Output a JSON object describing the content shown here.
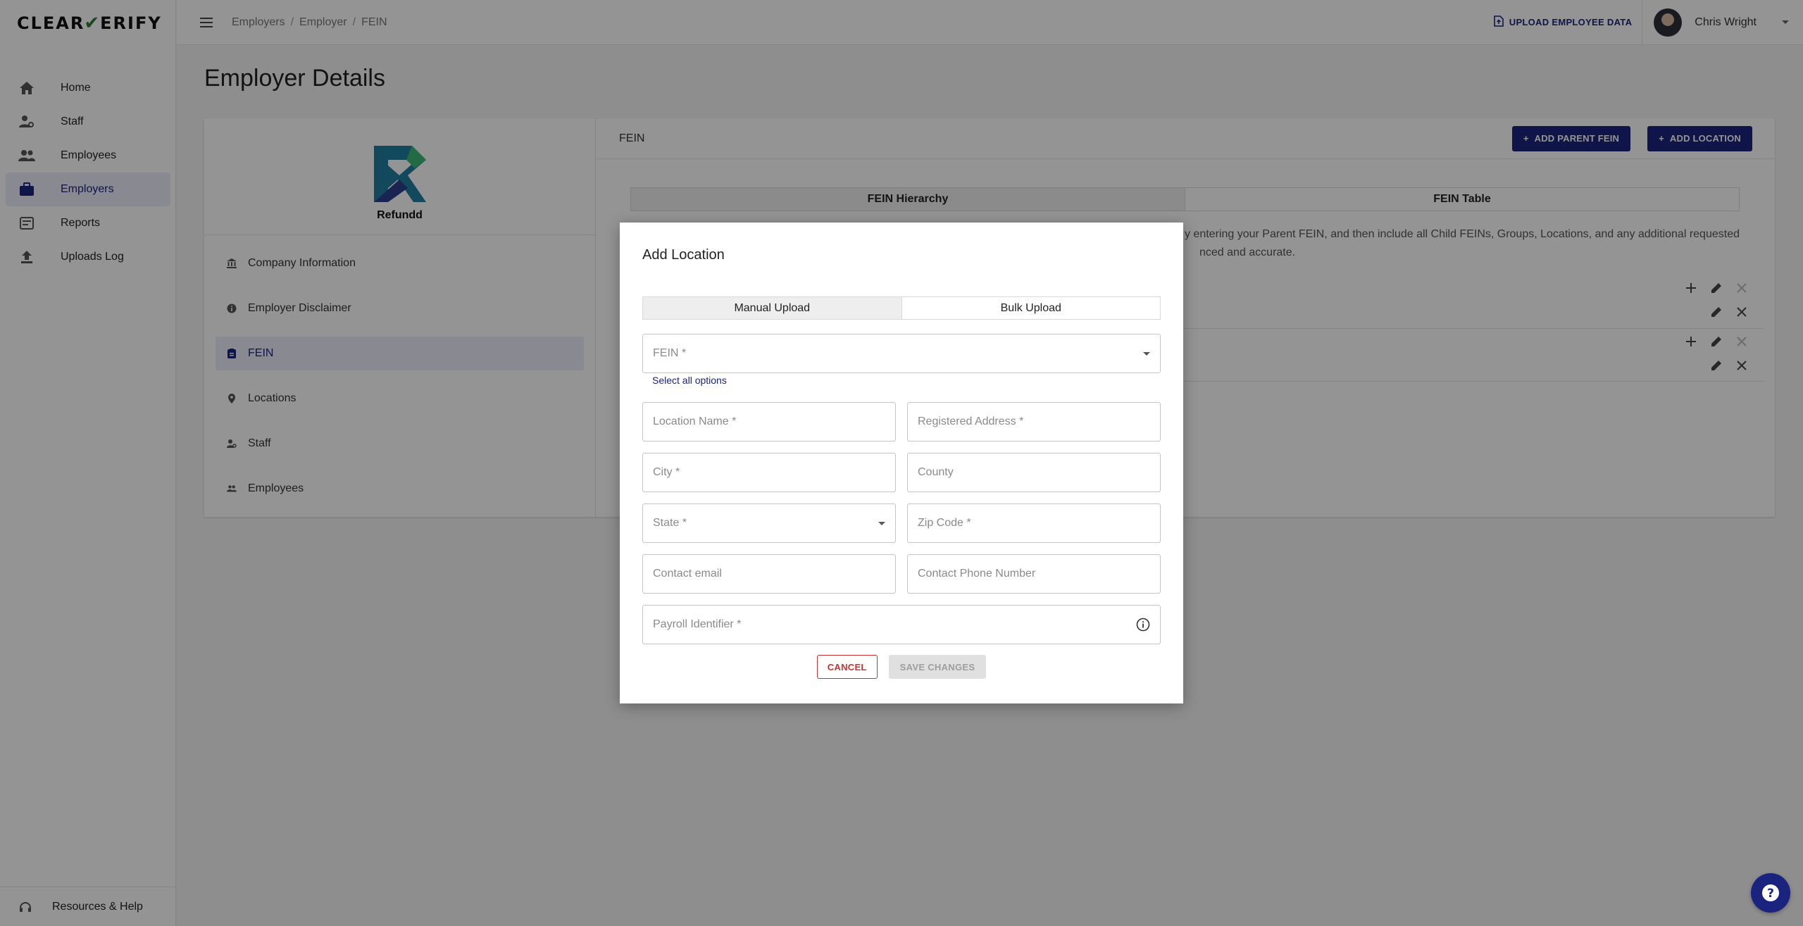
{
  "app": {
    "logo_left": "CLEAR",
    "logo_right": "ERIFY"
  },
  "sidebar": {
    "items": [
      {
        "label": "Home",
        "icon": "home-icon"
      },
      {
        "label": "Staff",
        "icon": "staff-icon"
      },
      {
        "label": "Employees",
        "icon": "employees-icon"
      },
      {
        "label": "Employers",
        "icon": "briefcase-icon"
      },
      {
        "label": "Reports",
        "icon": "reports-icon"
      },
      {
        "label": "Uploads Log",
        "icon": "upload-icon"
      }
    ],
    "footer": "Resources & Help"
  },
  "header": {
    "breadcrumb": [
      "Employers",
      "Employer",
      "FEIN"
    ],
    "upload_label": "UPLOAD EMPLOYEE DATA",
    "user_name": "Chris Wright"
  },
  "page": {
    "title": "Employer Details"
  },
  "employer": {
    "name": "Refundd",
    "menu": [
      {
        "label": "Company Information",
        "icon": "bank-icon"
      },
      {
        "label": "Employer Disclaimer",
        "icon": "info-icon"
      },
      {
        "label": "FEIN",
        "icon": "fein-icon"
      },
      {
        "label": "Locations",
        "icon": "location-pin-icon"
      },
      {
        "label": "Staff",
        "icon": "staff-icon"
      },
      {
        "label": "Employees",
        "icon": "people-icon"
      }
    ]
  },
  "fein_panel": {
    "title": "FEIN",
    "add_parent_label": "ADD PARENT FEIN",
    "add_location_label": "ADD LOCATION",
    "tabs": [
      "FEIN Hierarchy",
      "FEIN Table"
    ],
    "desc_line1": "y entering your Parent FEIN, and then include all Child FEINs, Groups, Locations, and any additional requested",
    "desc_line2": "nced and accurate."
  },
  "modal": {
    "title": "Add Location",
    "tabs": [
      "Manual Upload",
      "Bulk Upload"
    ],
    "fein_label": "FEIN *",
    "select_all": "Select all options",
    "location_name": "Location Name *",
    "registered_address": "Registered Address *",
    "city": "City *",
    "county": "County",
    "state": "State *",
    "zip": "Zip Code *",
    "contact_email": "Contact email",
    "contact_phone": "Contact Phone Number",
    "payroll_identifier": "Payroll Identifier *",
    "cancel_label": "CANCEL",
    "save_label": "SAVE CHANGES"
  },
  "colors": {
    "primary": "#1a237e",
    "danger": "#d32f2f",
    "check": "#2e7d32"
  }
}
